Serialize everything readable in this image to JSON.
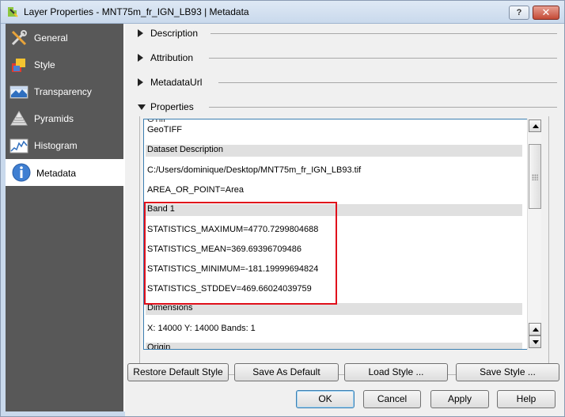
{
  "window": {
    "title": "Layer Properties - MNT75m_fr_IGN_LB93 | Metadata",
    "help_label": "?",
    "close_label": "✕"
  },
  "sidebar": {
    "items": [
      {
        "label": "General",
        "icon": "wrench-screwdriver-icon"
      },
      {
        "label": "Style",
        "icon": "paint-icon"
      },
      {
        "label": "Transparency",
        "icon": "transparency-icon"
      },
      {
        "label": "Pyramids",
        "icon": "pyramid-icon"
      },
      {
        "label": "Histogram",
        "icon": "histogram-icon"
      },
      {
        "label": "Metadata",
        "icon": "info-icon"
      }
    ],
    "active": "Metadata"
  },
  "groups": {
    "description": "Description",
    "attribution": "Attribution",
    "metadataurl": "MetadataUrl",
    "properties": "Properties"
  },
  "properties_list": {
    "rows": [
      {
        "text": "GTiff",
        "header": false
      },
      {
        "text": "GeoTIFF",
        "header": false
      },
      {
        "text": "Dataset Description",
        "header": true
      },
      {
        "text": "C:/Users/dominique/Desktop/MNT75m_fr_IGN_LB93.tif",
        "header": false
      },
      {
        "text": "AREA_OR_POINT=Area",
        "header": false
      },
      {
        "text": "Band 1",
        "header": true
      },
      {
        "text": "STATISTICS_MAXIMUM=4770.7299804688",
        "header": false
      },
      {
        "text": "STATISTICS_MEAN=369.69396709486",
        "header": false
      },
      {
        "text": "STATISTICS_MINIMUM=-181.19999694824",
        "header": false
      },
      {
        "text": "STATISTICS_STDDEV=469.66024039759",
        "header": false
      },
      {
        "text": "Dimensions",
        "header": true
      },
      {
        "text": "X: 14000 Y: 14000 Bands: 1",
        "header": false
      },
      {
        "text": "Origin",
        "header": true
      }
    ]
  },
  "style_buttons": {
    "restore": "Restore Default Style",
    "save_default": "Save As Default",
    "load": "Load Style ...",
    "save": "Save Style ..."
  },
  "dialog_buttons": {
    "ok": "OK",
    "cancel": "Cancel",
    "apply": "Apply",
    "help": "Help"
  },
  "colors": {
    "sidebar_bg": "#585858",
    "highlight_box": "#e0101b",
    "list_border": "#3c7fb1"
  }
}
